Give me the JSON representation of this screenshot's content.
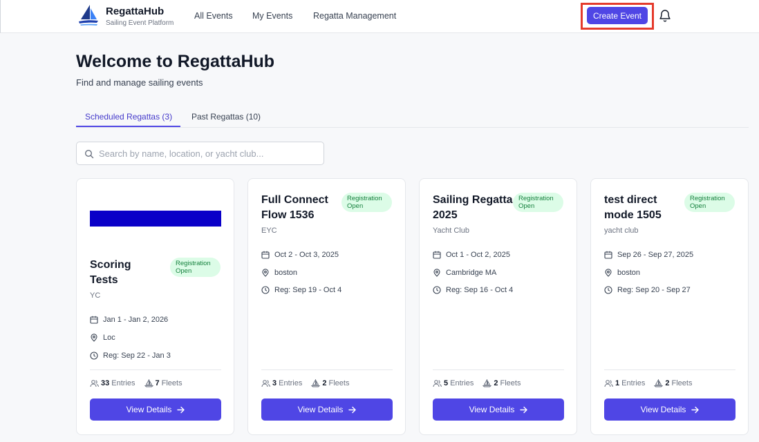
{
  "header": {
    "brand_name": "RegattaHub",
    "brand_subtitle": "Sailing Event Platform",
    "nav": [
      "All Events",
      "My Events",
      "Regatta Management"
    ],
    "create_label": "Create Event"
  },
  "main": {
    "title": "Welcome to RegattaHub",
    "subtitle": "Find and manage sailing events",
    "tabs": [
      "Scheduled Regattas (3)",
      "Past Regattas (10)"
    ],
    "search_placeholder": "Search by name, location, or yacht club..."
  },
  "cards": [
    {
      "title_lines": [
        "Scoring",
        "Tests"
      ],
      "badge": [
        "Registration",
        "Open"
      ],
      "club": "YC",
      "dates": "Jan 1 - Jan 2, 2026",
      "location": "Loc",
      "reg": "Reg: Sep 22 - Jan 3",
      "entries_count": "33",
      "entries_label": "Entries",
      "fleets_count": "7",
      "fleets_label": "Fleets",
      "button": "View Details"
    },
    {
      "title_lines": [
        "Full Connect",
        "Flow 1536"
      ],
      "badge": [
        "Registration",
        "Open"
      ],
      "club": "EYC",
      "dates": "Oct 2 - Oct 3, 2025",
      "location": "boston",
      "reg": "Reg: Sep 19 - Oct 4",
      "entries_count": "3",
      "entries_label": "Entries",
      "fleets_count": "2",
      "fleets_label": "Fleets",
      "button": "View Details"
    },
    {
      "title_lines": [
        "Sailing Regatta",
        "2025"
      ],
      "badge": [
        "Registration",
        "Open"
      ],
      "club": "Yacht Club",
      "dates": "Oct 1 - Oct 2, 2025",
      "location": "Cambridge MA",
      "reg": "Reg: Sep 16 - Oct 4",
      "entries_count": "5",
      "entries_label": "Entries",
      "fleets_count": "2",
      "fleets_label": "Fleets",
      "button": "View Details"
    },
    {
      "title_lines": [
        "test direct",
        "mode 1505"
      ],
      "badge": [
        "Registration",
        "Open"
      ],
      "club": "yacht club",
      "dates": "Sep 26 - Sep 27, 2025",
      "location": "boston",
      "reg": "Reg: Sep 20 - Sep 27",
      "entries_count": "1",
      "entries_label": "Entries",
      "fleets_count": "2",
      "fleets_label": "Fleets",
      "button": "View Details"
    }
  ],
  "colors": {
    "accent": "#4f46e5",
    "badge_bg": "#dcfce7",
    "badge_text": "#15803d",
    "highlight": "#e53b2c",
    "card_image": "#0a00c8"
  }
}
